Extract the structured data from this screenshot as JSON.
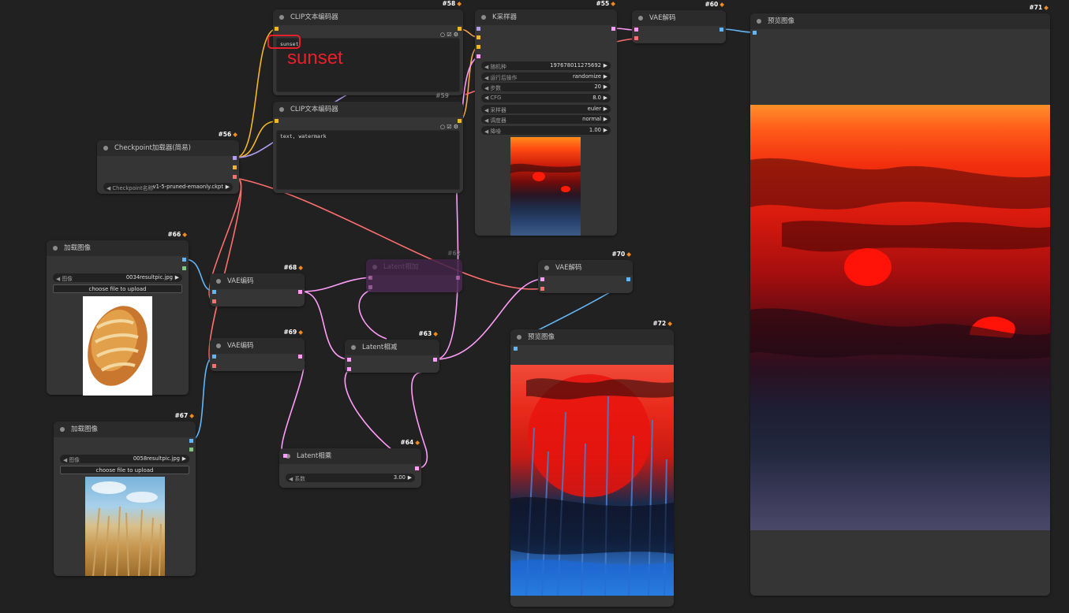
{
  "nodes": {
    "clip58": {
      "id": "#58",
      "title": "CLIP文本编码器",
      "prompt": "sunset"
    },
    "clip59": {
      "id": "#59",
      "title": "CLIP文本编码器",
      "prompt": "text, watermark"
    },
    "ksampler55": {
      "id": "#55",
      "title": "K采样器",
      "widgets": [
        {
          "label": "随机种",
          "value": "197678011275692"
        },
        {
          "label": "运行后操作",
          "value": "randomize"
        },
        {
          "label": "步数",
          "value": "20"
        },
        {
          "label": "CFG",
          "value": "8.0"
        },
        {
          "label": "采样器",
          "value": "euler"
        },
        {
          "label": "调度器",
          "value": "normal"
        },
        {
          "label": "降噪",
          "value": "1.00"
        }
      ]
    },
    "vaedecode60": {
      "id": "#60",
      "title": "VAE解码"
    },
    "preview71": {
      "id": "#71",
      "title": "预览图像"
    },
    "checkpoint56": {
      "id": "#56",
      "title": "Checkpoint加载器(简易)",
      "widget_label": "Checkpoint名称",
      "widget_value": "v1-5-pruned-emaonly.ckpt"
    },
    "load66": {
      "id": "#66",
      "title": "加载图像",
      "widget_label": "图像",
      "widget_value": "0034resultpic.jpg",
      "upload": "choose file to upload"
    },
    "load67": {
      "id": "#67",
      "title": "加载图像",
      "widget_label": "图像",
      "widget_value": "0058resultpic.jpg",
      "upload": "choose file to upload"
    },
    "vaeencode68": {
      "id": "#68",
      "title": "VAE编码"
    },
    "vaeencode69": {
      "id": "#69",
      "title": "VAE编码"
    },
    "latentadd62": {
      "id": "#62",
      "title": "Latent相加"
    },
    "latentsub63": {
      "id": "#63",
      "title": "Latent相减"
    },
    "latentmul64": {
      "id": "#64",
      "title": "Latent相乘",
      "widget_label": "系数",
      "widget_value": "3.00"
    },
    "vaedecode70": {
      "id": "#70",
      "title": "VAE解码"
    },
    "preview72": {
      "id": "#72",
      "title": "预览图像"
    }
  },
  "annotation": {
    "text": "sunset",
    "color": "#e8202a"
  },
  "port_colors": {
    "clip": "#f5b529",
    "model": "#b29cf0",
    "vae": "#ff6e6e",
    "latent": "#ff9cf9",
    "image": "#64b5f6",
    "mask": "#81c784"
  },
  "icons": {
    "node_id_badge": "fox-icon",
    "prompt_tools": [
      "circle-icon",
      "checkbox-icon",
      "settings-icon"
    ]
  }
}
